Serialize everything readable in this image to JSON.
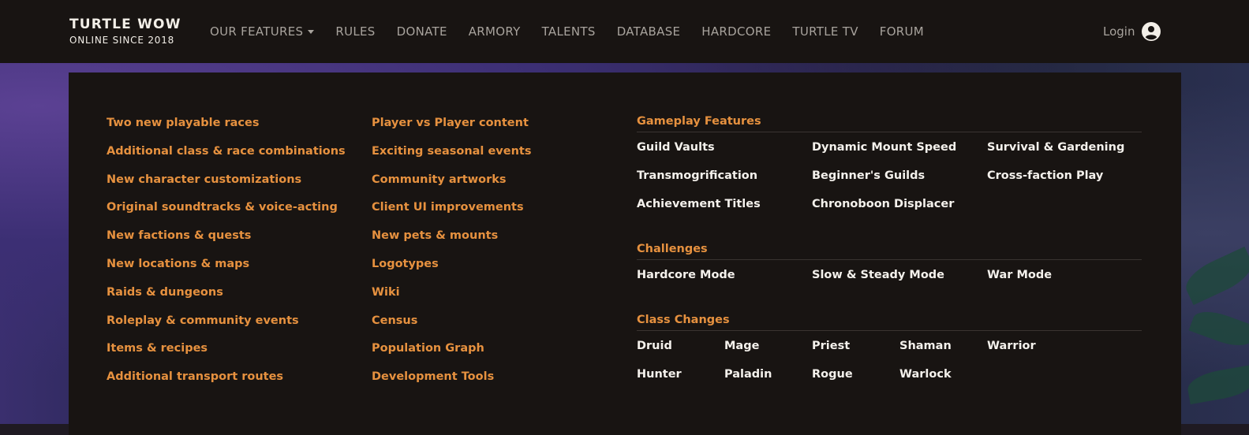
{
  "brand": {
    "title": "TURTLE WOW",
    "subtitle": "ONLINE SINCE 2018"
  },
  "nav": {
    "items": [
      "OUR FEATURES",
      "RULES",
      "DONATE",
      "ARMORY",
      "TALENTS",
      "DATABASE",
      "HARDCORE",
      "TURTLE TV",
      "FORUM"
    ],
    "login_label": "Login"
  },
  "features": {
    "column_a": [
      "Two new playable races",
      "Additional class & race combinations",
      "New character customizations",
      "Original soundtracks & voice-acting",
      "New factions & quests",
      "New locations & maps",
      "Raids & dungeons",
      "Roleplay & community events",
      "Items & recipes",
      "Additional transport routes"
    ],
    "column_b": [
      "Player vs Player content",
      "Exciting seasonal events",
      "Community artworks",
      "Client UI improvements",
      "New pets & mounts",
      "Logotypes",
      "Wiki",
      "Census",
      "Population Graph",
      "Development Tools"
    ]
  },
  "gameplay": {
    "title": "Gameplay Features",
    "items": [
      "Guild Vaults",
      "Dynamic Mount Speed",
      "Survival & Gardening",
      "Transmogrification",
      "Beginner's Guilds",
      "Cross-faction Play",
      "Achievement Titles",
      "Chronoboon Displacer"
    ]
  },
  "challenges": {
    "title": "Challenges",
    "items": [
      "Hardcore Mode",
      "Slow & Steady Mode",
      "War Mode"
    ]
  },
  "class_changes": {
    "title": "Class Changes",
    "items": [
      "Druid",
      "Mage",
      "Priest",
      "Shaman",
      "Warrior",
      "Hunter",
      "Paladin",
      "Rogue",
      "Warlock"
    ]
  },
  "colors": {
    "accent": "#e6913f",
    "navbar": "#181412",
    "text_light": "#f4f1ec",
    "nav_text": "#a8a39d"
  }
}
